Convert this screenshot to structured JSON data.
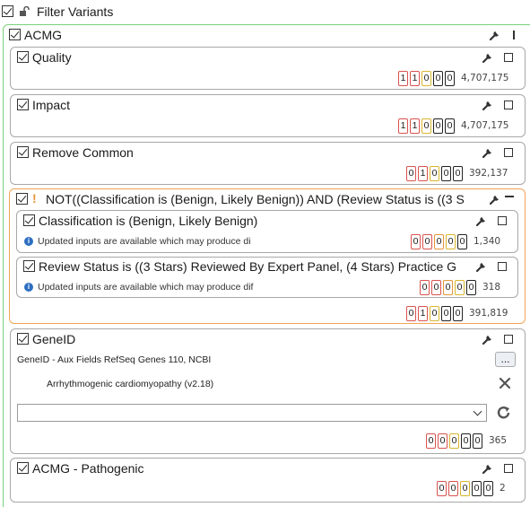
{
  "header": {
    "title": "Filter Variants"
  },
  "acmg": {
    "title": "ACMG"
  },
  "quality": {
    "title": "Quality",
    "counts": [
      "1",
      "1",
      "0",
      "0",
      "0"
    ],
    "total": "4,707,175"
  },
  "impact": {
    "title": "Impact",
    "counts": [
      "1",
      "1",
      "0",
      "0",
      "0"
    ],
    "total": "4,707,175"
  },
  "remove_common": {
    "title": "Remove Common",
    "counts": [
      "0",
      "1",
      "0",
      "0",
      "0"
    ],
    "total": "392,137"
  },
  "not_group": {
    "title": "NOT((Classification is (Benign, Likely Benign)) AND (Review Status is ((3 S",
    "counts": [
      "0",
      "1",
      "0",
      "0",
      "0"
    ],
    "total": "391,819",
    "classification": {
      "title": "Classification is (Benign, Likely Benign)",
      "info": "Updated inputs are available which may produce di",
      "counts": [
        "0",
        "0",
        "0",
        "0",
        "0"
      ],
      "total": "1,340"
    },
    "review": {
      "title": "Review Status is ((3 Stars) Reviewed By Expert Panel, (4 Stars) Practice G",
      "info": "Updated inputs are available which may produce dif",
      "counts": [
        "0",
        "0",
        "0",
        "0",
        "0"
      ],
      "total": "318"
    }
  },
  "geneid": {
    "title": "GeneID",
    "source": "GeneID - Aux Fields RefSeq Genes 110, NCBI",
    "browse_label": "...",
    "list_item": "Arrhythmogenic cardiomyopathy (v2.18)",
    "dropdown_value": "",
    "counts": [
      "0",
      "0",
      "0",
      "0",
      "0"
    ],
    "total": "365"
  },
  "acmg_pathogenic": {
    "title": "ACMG - Pathogenic",
    "counts": [
      "0",
      "0",
      "0",
      "0",
      "0"
    ],
    "total": "2"
  },
  "colors": {
    "group_border": "#7ccf7c",
    "not_border": "#f2a456",
    "count_red": "#d9534f",
    "count_orange": "#e8953a",
    "count_yellow": "#d8b62e"
  }
}
